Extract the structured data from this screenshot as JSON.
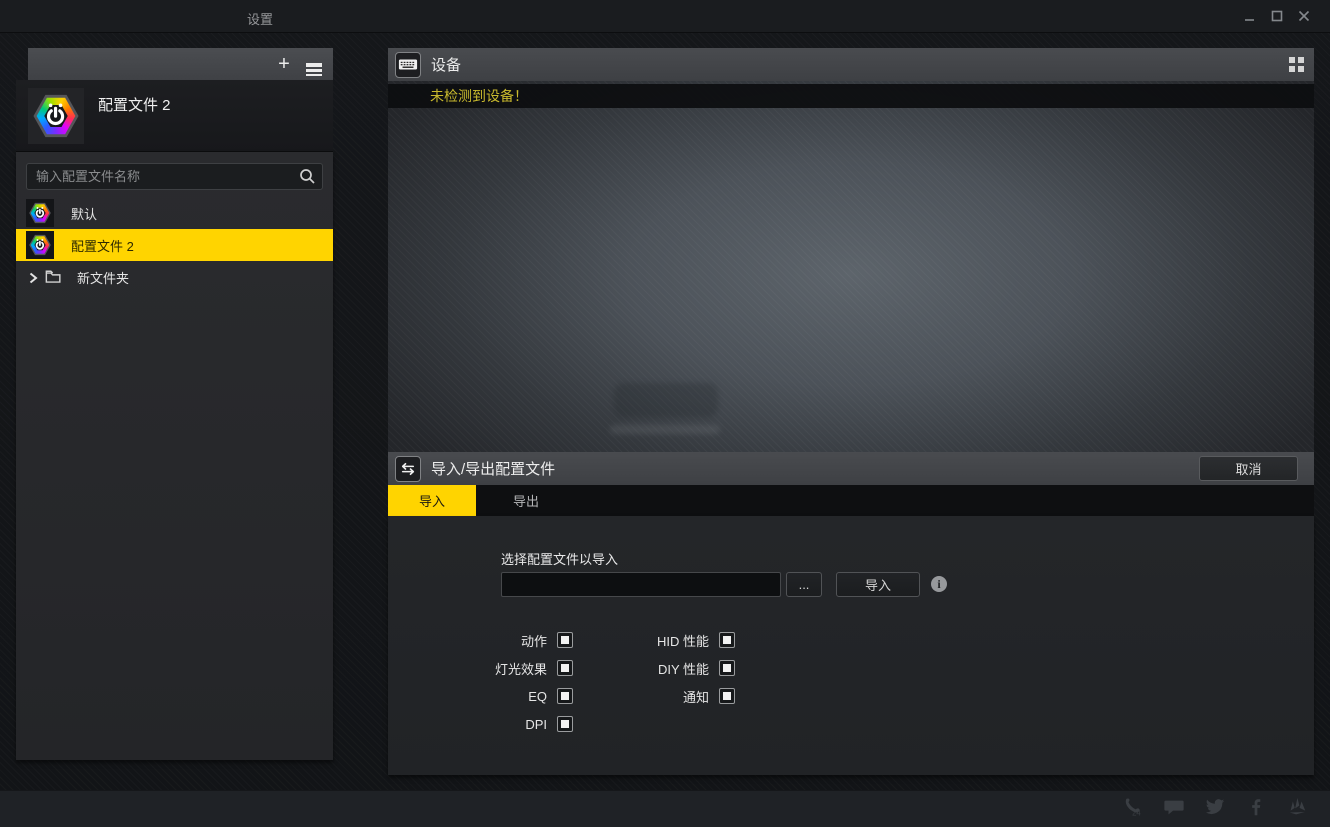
{
  "window": {
    "title": "设置"
  },
  "sidebar": {
    "profile_title": "配置文件 2",
    "search_placeholder": "输入配置文件名称",
    "items": [
      {
        "label": "默认",
        "type": "profile",
        "selected": false
      },
      {
        "label": "配置文件 2",
        "type": "profile",
        "selected": true
      },
      {
        "label": "新文件夹",
        "type": "folder",
        "selected": false
      }
    ]
  },
  "device_panel": {
    "title": "设备",
    "warning": "未检测到设备！"
  },
  "import_export": {
    "title": "导入/导出配置文件",
    "cancel_label": "取消",
    "tabs": [
      {
        "label": "导入",
        "active": true
      },
      {
        "label": "导出",
        "active": false
      }
    ],
    "form": {
      "label": "选择配置文件以导入",
      "input_value": "",
      "browse_label": "...",
      "import_label": "导入",
      "info_glyph": "i"
    },
    "options_left": [
      {
        "label": "动作",
        "checked": true
      },
      {
        "label": "灯光效果",
        "checked": true
      },
      {
        "label": "EQ",
        "checked": true
      },
      {
        "label": "DPI",
        "checked": true
      }
    ],
    "options_right": [
      {
        "label": "HID 性能",
        "checked": true
      },
      {
        "label": "DIY 性能",
        "checked": true
      },
      {
        "label": "通知",
        "checked": true
      }
    ]
  },
  "footer": {
    "icons": [
      "phone-support-24-icon",
      "chat-icon",
      "twitter-icon",
      "facebook-icon",
      "corsair-logo-icon"
    ]
  },
  "colors": {
    "accent_yellow": "#ffd400",
    "warning_text": "#c9ba2e",
    "header_gray": "#46484c",
    "panel_dark": "#232528"
  }
}
